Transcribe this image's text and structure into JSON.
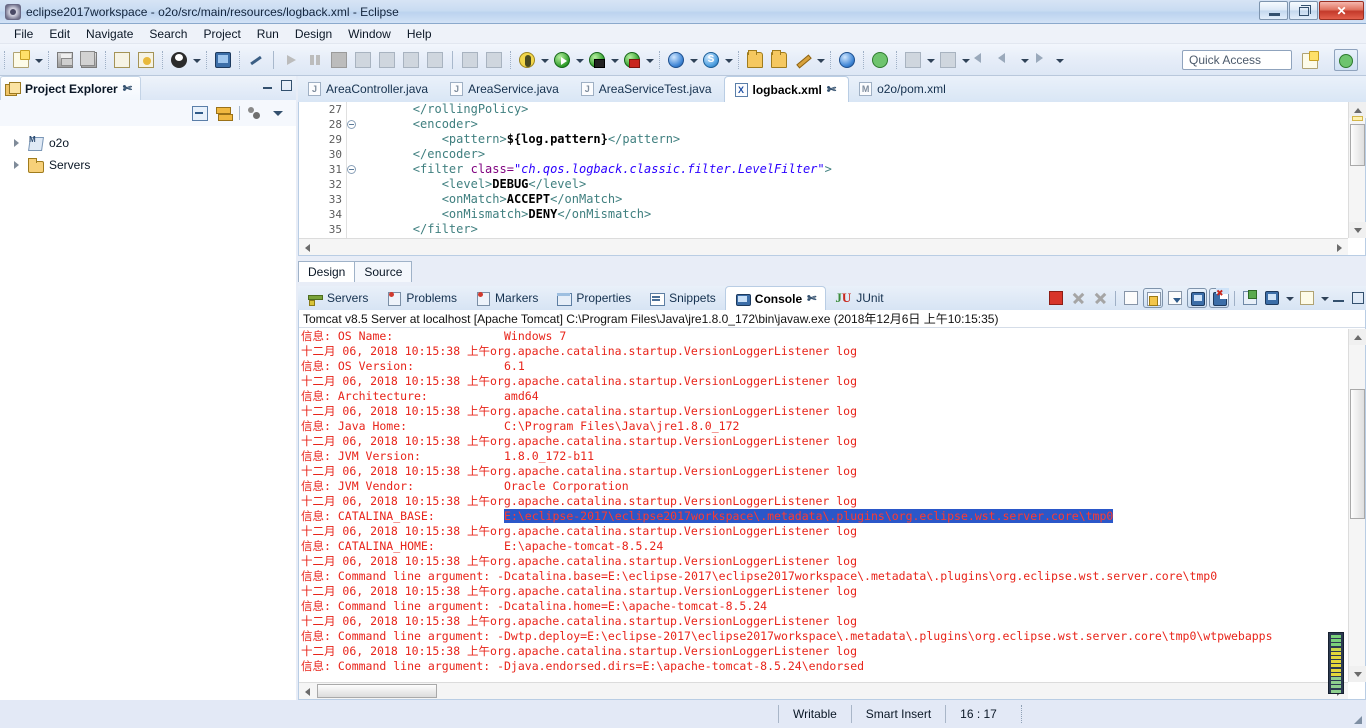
{
  "window": {
    "title": "eclipse2017workspace - o2o/src/main/resources/logback.xml - Eclipse",
    "app_icon": "eclipse-icon",
    "controls": {
      "minimize": "minimize-button",
      "restore": "restore-button",
      "close": "✕"
    }
  },
  "menu": {
    "items": [
      "File",
      "Edit",
      "Navigate",
      "Search",
      "Project",
      "Run",
      "Design",
      "Window",
      "Help"
    ]
  },
  "toolbar": {
    "quick_access_placeholder": "Quick Access",
    "items": [
      {
        "name": "new-wizard-icon"
      },
      {
        "name": "new-dropdown-arrow"
      },
      {
        "name": "save-icon"
      },
      {
        "name": "save-all-icon"
      },
      {
        "name": "print-icon"
      },
      {
        "name": "refresh-resource-icon"
      },
      {
        "name": "user-icon"
      },
      {
        "name": "user-dropdown-arrow"
      },
      {
        "name": "open-console-icon"
      },
      {
        "name": "toggle-breakpoint-icon"
      },
      {
        "name": "resume-icon"
      },
      {
        "name": "suspend-icon"
      },
      {
        "name": "terminate-icon"
      },
      {
        "name": "disconnect-icon"
      },
      {
        "name": "step-over-icon"
      },
      {
        "name": "step-return-icon"
      },
      {
        "name": "step-into-icon"
      },
      {
        "name": "skip-breakpoints-icon"
      },
      {
        "name": "drop-to-frame-icon"
      },
      {
        "name": "debug-icon"
      },
      {
        "name": "debug-dropdown-arrow"
      },
      {
        "name": "run-icon"
      },
      {
        "name": "run-dropdown-arrow"
      },
      {
        "name": "run-as-server-icon"
      },
      {
        "name": "run-as-dropdown-arrow"
      },
      {
        "name": "profile-icon"
      },
      {
        "name": "profile-dropdown-arrow"
      },
      {
        "name": "open-web-browser-icon"
      },
      {
        "name": "browser-dropdown-arrow"
      },
      {
        "name": "spring-icon"
      },
      {
        "name": "spring-dropdown-arrow"
      },
      {
        "name": "open-type-icon"
      },
      {
        "name": "open-task-icon"
      },
      {
        "name": "annotation-icon"
      },
      {
        "name": "annotation-dropdown-arrow"
      },
      {
        "name": "web-perspective-icon"
      },
      {
        "name": "run-server-icon"
      },
      {
        "name": "previous-annotation-icon"
      },
      {
        "name": "previous-dropdown-arrow"
      },
      {
        "name": "next-annotation-icon"
      },
      {
        "name": "next-dropdown-arrow"
      },
      {
        "name": "back-history-icon"
      },
      {
        "name": "back-icon"
      },
      {
        "name": "back-dropdown-arrow"
      },
      {
        "name": "forward-icon"
      },
      {
        "name": "forward-dropdown-arrow"
      }
    ],
    "perspective_new": "new-perspective-icon",
    "perspective_current": "java-ee-perspective-icon"
  },
  "project_explorer": {
    "tab_label": "Project Explorer",
    "close_glyph": "✄",
    "toolbar": [
      "collapse-all-icon",
      "link-with-editor-icon",
      "view-menu-dots-icon",
      "view-menu-arrow-icon"
    ],
    "minimize": "minimize-icon",
    "maximize": "maximize-icon",
    "tree": [
      {
        "label": "o2o",
        "icon": "maven-project-icon",
        "expanded": false
      },
      {
        "label": "Servers",
        "icon": "folder-icon",
        "expanded": false
      }
    ]
  },
  "editor": {
    "tabs": [
      {
        "label": "AreaController.java",
        "type": "J",
        "active": false
      },
      {
        "label": "AreaService.java",
        "type": "J",
        "active": false
      },
      {
        "label": "AreaServiceTest.java",
        "type": "J",
        "active": false
      },
      {
        "label": "logback.xml",
        "type": "X",
        "active": true
      },
      {
        "label": "o2o/pom.xml",
        "type": "M",
        "active": false
      }
    ],
    "gutter_start": 27,
    "lines": [
      {
        "n": 27,
        "fold": false,
        "indent": 8,
        "segs": [
          {
            "t": "</rollingPolicy>",
            "c": "tag"
          }
        ]
      },
      {
        "n": 28,
        "fold": true,
        "indent": 8,
        "segs": [
          {
            "t": "<encoder>",
            "c": "tag"
          }
        ]
      },
      {
        "n": 29,
        "fold": false,
        "indent": 12,
        "segs": [
          {
            "t": "<pattern>",
            "c": "tag"
          },
          {
            "t": "${log.pattern}",
            "c": "txt"
          },
          {
            "t": "</pattern>",
            "c": "tag"
          }
        ]
      },
      {
        "n": 30,
        "fold": false,
        "indent": 8,
        "segs": [
          {
            "t": "</encoder>",
            "c": "tag"
          }
        ]
      },
      {
        "n": 31,
        "fold": true,
        "indent": 8,
        "segs": [
          {
            "t": "<filter ",
            "c": "tag"
          },
          {
            "t": "class=",
            "c": "attr"
          },
          {
            "t": "\"ch.qos.logback.classic.filter.LevelFilter\"",
            "c": "val"
          },
          {
            "t": ">",
            "c": "tag"
          }
        ]
      },
      {
        "n": 32,
        "fold": false,
        "indent": 12,
        "segs": [
          {
            "t": "<level>",
            "c": "tag"
          },
          {
            "t": "DEBUG",
            "c": "txt"
          },
          {
            "t": "</level>",
            "c": "tag"
          }
        ]
      },
      {
        "n": 33,
        "fold": false,
        "indent": 12,
        "segs": [
          {
            "t": "<onMatch>",
            "c": "tag"
          },
          {
            "t": "ACCEPT",
            "c": "txt"
          },
          {
            "t": "</onMatch>",
            "c": "tag"
          }
        ]
      },
      {
        "n": 34,
        "fold": false,
        "indent": 12,
        "segs": [
          {
            "t": "<onMismatch>",
            "c": "tag"
          },
          {
            "t": "DENY",
            "c": "txt"
          },
          {
            "t": "</onMismatch>",
            "c": "tag"
          }
        ]
      },
      {
        "n": 35,
        "fold": false,
        "indent": 8,
        "segs": [
          {
            "t": "</filter>",
            "c": "tag"
          }
        ]
      }
    ],
    "bottom_tabs": [
      {
        "label": "Design",
        "active": true
      },
      {
        "label": "Source",
        "active": false
      }
    ]
  },
  "console_panel": {
    "tabs": [
      {
        "label": "Servers",
        "icon": "servers-icon",
        "active": false
      },
      {
        "label": "Problems",
        "icon": "problems-icon",
        "active": false
      },
      {
        "label": "Markers",
        "icon": "markers-icon",
        "active": false
      },
      {
        "label": "Properties",
        "icon": "properties-icon",
        "active": false
      },
      {
        "label": "Snippets",
        "icon": "snippets-icon",
        "active": false
      },
      {
        "label": "Console",
        "icon": "console-icon",
        "active": true,
        "close_glyph": "✄"
      },
      {
        "label": "JUnit",
        "icon": "junit-icon",
        "active": false
      }
    ],
    "toolbar": [
      {
        "name": "terminate-button",
        "pressed": false
      },
      {
        "name": "remove-launch-button",
        "pressed": false
      },
      {
        "name": "remove-all-launches-button",
        "pressed": false
      },
      {
        "name": "clear-console-button",
        "pressed": false
      },
      {
        "name": "scroll-lock-button",
        "pressed": true
      },
      {
        "name": "word-wrap-button",
        "pressed": false
      },
      {
        "name": "show-console-on-output-button",
        "pressed": true
      },
      {
        "name": "show-console-on-error-button",
        "pressed": true
      },
      {
        "name": "pin-console-button",
        "pressed": false
      },
      {
        "name": "display-selected-console-button",
        "pressed": false
      },
      {
        "name": "display-console-dropdown-arrow",
        "pressed": false
      },
      {
        "name": "open-console-button",
        "pressed": false
      },
      {
        "name": "open-console-dropdown-arrow",
        "pressed": false
      }
    ],
    "minimize": "minimize-icon",
    "maximize": "maximize-icon",
    "title": "Tomcat v8.5 Server at localhost [Apache Tomcat] C:\\Program Files\\Java\\jre1.8.0_172\\bin\\javaw.exe (2018年12月6日 上午10:15:35)",
    "log_lines": [
      {
        "text": "信息: OS Name:                Windows 7"
      },
      {
        "text": "十二月 06, 2018 10:15:38 上午org.apache.catalina.startup.VersionLoggerListener log"
      },
      {
        "text": "信息: OS Version:             6.1"
      },
      {
        "text": "十二月 06, 2018 10:15:38 上午org.apache.catalina.startup.VersionLoggerListener log"
      },
      {
        "text": "信息: Architecture:           amd64"
      },
      {
        "text": "十二月 06, 2018 10:15:38 上午org.apache.catalina.startup.VersionLoggerListener log"
      },
      {
        "text": "信息: Java Home:              C:\\Program Files\\Java\\jre1.8.0_172"
      },
      {
        "text": "十二月 06, 2018 10:15:38 上午org.apache.catalina.startup.VersionLoggerListener log"
      },
      {
        "text": "信息: JVM Version:            1.8.0_172-b11"
      },
      {
        "text": "十二月 06, 2018 10:15:38 上午org.apache.catalina.startup.VersionLoggerListener log"
      },
      {
        "text": "信息: JVM Vendor:             Oracle Corporation"
      },
      {
        "text": "十二月 06, 2018 10:15:38 上午org.apache.catalina.startup.VersionLoggerListener log"
      },
      {
        "prefix": "信息: CATALINA_BASE:          ",
        "selected": "E:\\eclipse-2017\\eclipse2017workspace\\.metadata\\.plugins\\org.eclipse.wst.server.core\\tmp0"
      },
      {
        "text": "十二月 06, 2018 10:15:38 上午org.apache.catalina.startup.VersionLoggerListener log"
      },
      {
        "text": "信息: CATALINA_HOME:          E:\\apache-tomcat-8.5.24"
      },
      {
        "text": "十二月 06, 2018 10:15:38 上午org.apache.catalina.startup.VersionLoggerListener log"
      },
      {
        "text": "信息: Command line argument: -Dcatalina.base=E:\\eclipse-2017\\eclipse2017workspace\\.metadata\\.plugins\\org.eclipse.wst.server.core\\tmp0"
      },
      {
        "text": "十二月 06, 2018 10:15:38 上午org.apache.catalina.startup.VersionLoggerListener log"
      },
      {
        "text": "信息: Command line argument: -Dcatalina.home=E:\\apache-tomcat-8.5.24"
      },
      {
        "text": "十二月 06, 2018 10:15:38 上午org.apache.catalina.startup.VersionLoggerListener log"
      },
      {
        "text": "信息: Command line argument: -Dwtp.deploy=E:\\eclipse-2017\\eclipse2017workspace\\.metadata\\.plugins\\org.eclipse.wst.server.core\\tmp0\\wtpwebapps"
      },
      {
        "text": "十二月 06, 2018 10:15:38 上午org.apache.catalina.startup.VersionLoggerListener log"
      },
      {
        "text": "信息: Command line argument: -Djava.endorsed.dirs=E:\\apache-tomcat-8.5.24\\endorsed"
      }
    ]
  },
  "status_bar": {
    "writable": "Writable",
    "insert_mode": "Smart Insert",
    "cursor_position": "16 : 17"
  },
  "colors": {
    "console_text": "#e8241a",
    "selection_bg": "#2b57c9",
    "xml_tag": "#3f7f7f",
    "xml_attr": "#7f007f",
    "xml_value": "#2a00ff",
    "titlebar_close": "#c3392a"
  }
}
